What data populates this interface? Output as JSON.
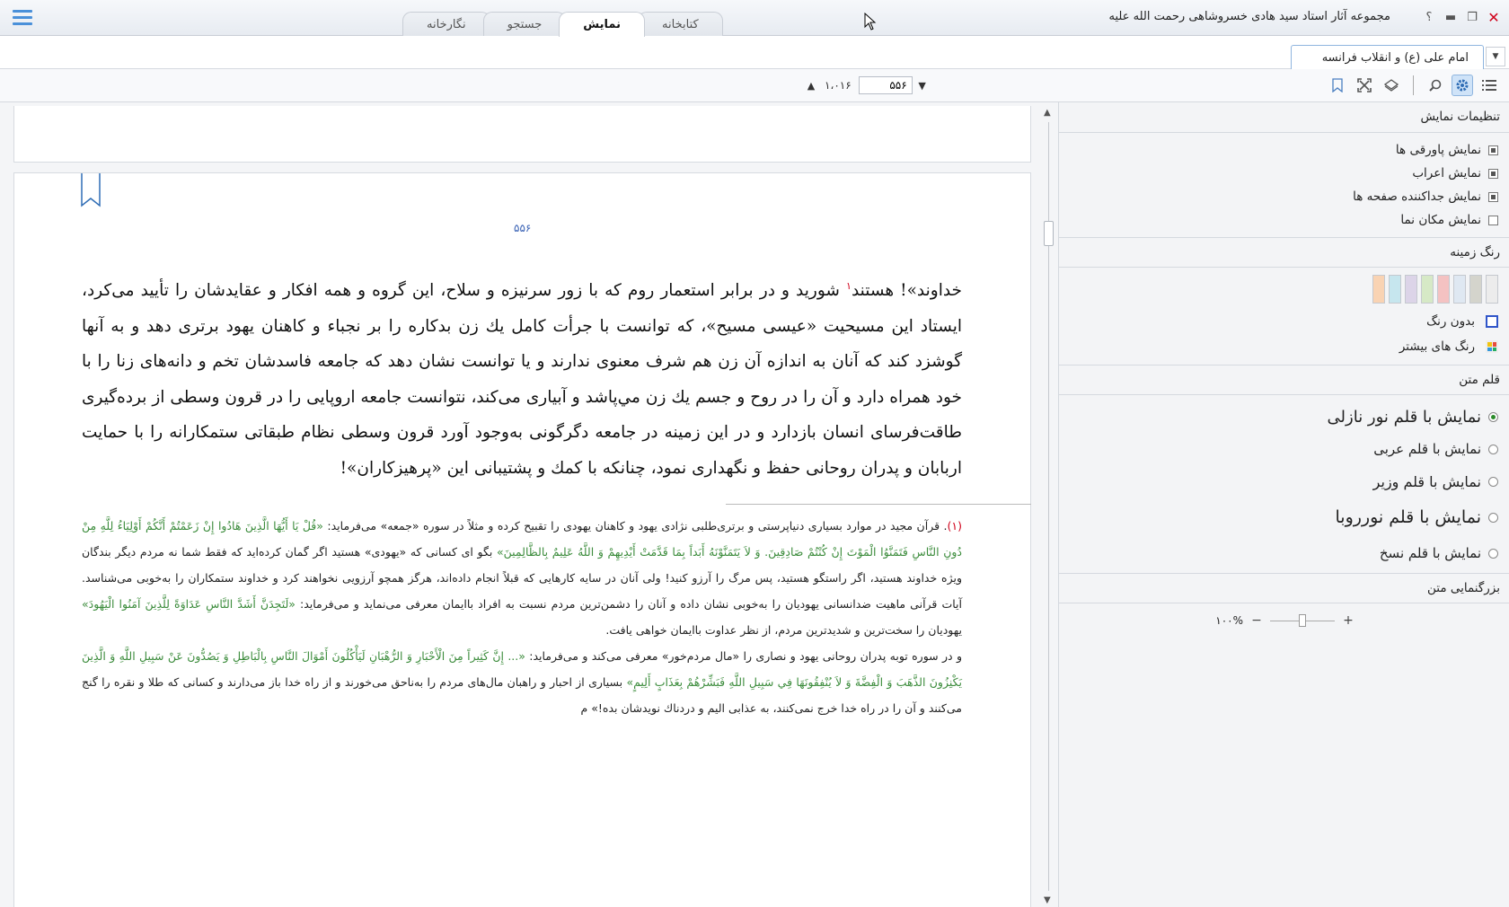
{
  "window": {
    "title": "مجموعه آثار استاد سید هادی خسروشاهی رحمت الله علیه",
    "help_glyph": "؟",
    "minimize_glyph": "▬",
    "restore_glyph": "❐",
    "close_glyph": "✕"
  },
  "tabs": [
    {
      "label": "نگارخانه"
    },
    {
      "label": "جستجو"
    },
    {
      "label": "نمایش"
    },
    {
      "label": "کتابخانه"
    }
  ],
  "active_tab": "نمایش",
  "document_tab": {
    "label": "امام علی (ع) و انقلاب فرانسه"
  },
  "pager": {
    "current": "۵۵۶",
    "total": "۱،۰۱۶"
  },
  "page": {
    "number": "۵۵۶",
    "body": [
      "خداوند»! هستند",
      "شورید و در برابر استعمار روم که با زور سرنیزه و سلاح، این گروه و همه افکار و عقایدشان را تأیید می‌کرد، ایستاد این مسیحیت «عیسی مسیح»، که توانست با جرأت کامل یك زن بدكاره را بر نجباء و كاهنان يهود برتری دهد و به آنها گوشزد کند که آنان به اندازه آن زن هم شرف معنوی ندارند و يا توانست نشان دهد كه جامعه فاسدشان تخم و دانه‌های زنا را با خود همراه دارد و آن را در روح و جسم يك زن مي‌پاشد و آبياری می‌کند، نتوانست جامعه اروپايی را در قرون وسطی از برده‌گیری طاقت‌فرسای انسان بازدارد و در اين زمينه در جامعه دگرگونی به‌وجود آورد قرون وسطی نظام طبقاتی ستمکارانه را با حمايت اربابان و پدران روحانی حفظ و نگهداری نمود، چنانکه با كمك و پشتيبانی اين «پرهيزكاران»!"
    ],
    "footnote_marker": "۱",
    "footnotes": {
      "number": "(۱)",
      "p1": [
        ". قرآن مجيد در موارد بسياری دنياپرستی و برتری‌طلبی نژادی يهود و كاهنان يهودی را تقبيح كرده و مثلاً در سوره «جمعه» می‌فرمايد: ",
        "«قُلْ يَا أَيُّهَا الَّذِينَ هَادُوا إِنْ زَعَمْتُمْ أَنَّكُمْ أَوْلِيَاءُ لِلَّهِ مِنْ دُونِ النَّاسِ فَتَمَنَّوُا الْمَوْتَ إِنْ كُنْتُمْ صَادِقِينَ. وَ لاَ يَتَمَنَّوْنَهُ أَبَداً بِمَا قَدَّمَتْ أَيْدِيهِمْ وَ اللَّهُ عَلِيمٌ بِالظَّالِمِينَ»",
        " بگو ای كسانی كه «يهودی» هستيد اگر گمان كرده‌ايد كه فقط شما نه مردم ديگر بندگان ويژه خداوند هستيد، اگر راستگو هستيد، پس مرگ را آرزو كنيد! ولی آنان در سايه كارهايی كه قبلاً انجام داده‌اند، هرگز همچو آرزويی نخواهند كرد و خداوند ستمكاران را به‌خوبی می‌شناسد. آيات قرآنی ماهيت ضدانسانی يهوديان را به‌خوبی نشان داده و آنان را دشمن‌ترين مردم نسبت به افراد باايمان معرفی می‌نمايد و می‌فرمايد: ",
        "«لَتَجِدَنَّ أَشَدَّ النَّاسِ عَدَاوَةً لِلَّذِينَ آمَنُوا الْيَهُودَ»",
        " يهوديان را سخت‌ترين و شديدترين مردم، از نظر عداوت باايمان خواهی يافت."
      ],
      "p2": [
        "و در سوره توبه پدران روحانی يهود و نصاری را «مال مردم‌خور» معرفی می‌كند و می‌فرمايد: ",
        "«... إِنَّ كَثِيراً مِنَ الْأَحْبَارِ وَ الرُّهْبَانِ لَيَأْكُلُونَ أَمْوَالَ النَّاسِ بِالْبَاطِلِ وَ يَصُدُّونَ عَنْ سَبِيلِ اللَّهِ وَ الَّذِينَ يَكْنِزُونَ الذَّهَبَ وَ الْفِضَّةَ وَ لاَ يُنْفِقُونَهَا فِي سَبِيلِ اللَّهِ فَبَشِّرْهُمْ بِعَذَابٍ أَلِيمٍ»",
        " بسياری از احبار و راهبان مال‌های مردم را به‌ناحق می‌خورند و از راه خدا باز می‌دارند و كسانی كه طلا و نقره را گنج می‌كنند و آن را در راه خدا خرج نمی‌كنند، به عذابی اليم و دردناك نويدشان بده!» م"
      ]
    }
  },
  "settings": {
    "display_title": "تنظیمات نمایش",
    "options": [
      {
        "label": "نمایش پاورقی ها",
        "checked": true
      },
      {
        "label": "نمایش اعراب",
        "checked": true
      },
      {
        "label": "نمایش جداکننده صفحه ها",
        "checked": true
      },
      {
        "label": "نمایش مکان نما",
        "checked": false
      }
    ],
    "bg_title": "رنگ زمینه",
    "swatches": [
      "#ececec",
      "#d4d4cc",
      "#dfe8f2",
      "#f4c2c2",
      "#d6e9c6",
      "#dcd4e8",
      "#c6e6ee",
      "#f9d3b3"
    ],
    "no_color": "بدون رنگ",
    "more_colors": "رنگ های بیشتر",
    "font_title": "قلم متن",
    "fonts": [
      {
        "label": "نمایش با قلم نور نازلی",
        "checked": true,
        "size": 18
      },
      {
        "label": "نمایش با قلم عربی",
        "checked": false,
        "size": 15
      },
      {
        "label": "نمایش با قلم وزیر",
        "checked": false,
        "size": 16
      },
      {
        "label": "نمایش با قلم نورروبا",
        "checked": false,
        "size": 19
      },
      {
        "label": "نمایش با قلم نسخ",
        "checked": false,
        "size": 15
      }
    ],
    "zoom_title": "بزرگنمایی متن",
    "zoom_value": "۱۰۰%",
    "zoom_fraction": 0.5
  }
}
